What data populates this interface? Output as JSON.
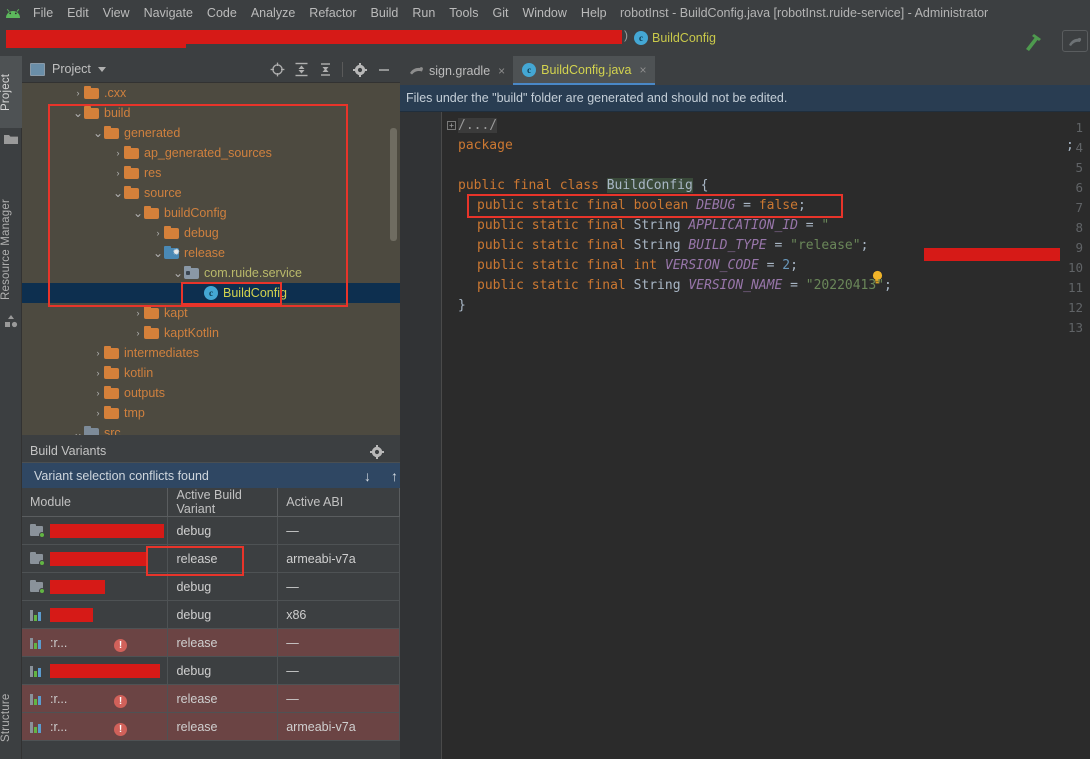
{
  "menu": {
    "logo_icon": "android-logo-icon",
    "items": [
      "File",
      "Edit",
      "View",
      "Navigate",
      "Code",
      "Analyze",
      "Refactor",
      "Build",
      "Run",
      "Tools",
      "Git",
      "Window",
      "Help"
    ],
    "window_title": "robotInst - BuildConfig.java [robotInst.ruide-service] - Administrator"
  },
  "navbar": {
    "breadcrumb_redacted": true,
    "separator": ")",
    "class_name": "BuildConfig",
    "class_icon": "c",
    "hammer_icon": "build-hammer-icon",
    "right_button_icon": "gradle-sync-icon"
  },
  "rail": {
    "project_tab": "Project",
    "resource_manager_tab": "Resource Manager",
    "structure_tab": "Structure"
  },
  "project_panel": {
    "title": "Project",
    "actions": [
      "locate-icon",
      "expand-all-icon",
      "collapse-all-icon",
      "settings-gear-icon",
      "hide-icon"
    ],
    "tree": [
      {
        "indent": 1,
        "arrow": "›",
        "icon": "folder",
        "label": ".cxx",
        "selected": false
      },
      {
        "indent": 1,
        "arrow": "⌄",
        "icon": "folder",
        "label": "build",
        "selected": false
      },
      {
        "indent": 2,
        "arrow": "⌄",
        "icon": "folder",
        "label": "generated",
        "selected": false
      },
      {
        "indent": 3,
        "arrow": "›",
        "icon": "folder",
        "label": "ap_generated_sources",
        "selected": false
      },
      {
        "indent": 3,
        "arrow": "›",
        "icon": "folder",
        "label": "res",
        "selected": false
      },
      {
        "indent": 3,
        "arrow": "⌄",
        "icon": "folder",
        "label": "source",
        "selected": false
      },
      {
        "indent": 4,
        "arrow": "⌄",
        "icon": "folder",
        "label": "buildConfig",
        "selected": false
      },
      {
        "indent": 5,
        "arrow": "›",
        "icon": "folder",
        "label": "debug",
        "selected": false
      },
      {
        "indent": 5,
        "arrow": "⌄",
        "icon": "folder-release",
        "label": "release",
        "selected": false
      },
      {
        "indent": 6,
        "arrow": "⌄",
        "icon": "folder-package",
        "label": "com.ruide.service",
        "selected": false
      },
      {
        "indent": 7,
        "arrow": "",
        "icon": "java-class",
        "label": "BuildConfig",
        "selected": true
      },
      {
        "indent": 4,
        "arrow": "›",
        "icon": "folder",
        "label": "kapt",
        "selected": false
      },
      {
        "indent": 4,
        "arrow": "›",
        "icon": "folder",
        "label": "kaptKotlin",
        "selected": false
      },
      {
        "indent": 2,
        "arrow": "›",
        "icon": "folder",
        "label": "intermediates",
        "selected": false
      },
      {
        "indent": 2,
        "arrow": "›",
        "icon": "folder",
        "label": "kotlin",
        "selected": false
      },
      {
        "indent": 2,
        "arrow": "›",
        "icon": "folder",
        "label": "outputs",
        "selected": false
      },
      {
        "indent": 2,
        "arrow": "›",
        "icon": "folder",
        "label": "tmp",
        "selected": false
      },
      {
        "indent": 1,
        "arrow": "⌄",
        "icon": "folder-src",
        "label": "src",
        "selected": false
      }
    ]
  },
  "build_variants": {
    "title": "Build Variants",
    "actions": [
      "settings-gear-icon",
      "hide-icon"
    ],
    "conflict_banner": "Variant selection conflicts found",
    "conflict_down_icon": "↓",
    "conflict_up_icon": "↑",
    "columns": [
      "Module",
      "Active Build Variant",
      "Active ABI"
    ],
    "rows": [
      {
        "module": "",
        "module_redacted": true,
        "redact_width": 114,
        "icon": "library-module-icon",
        "variant": "debug",
        "abi": "—",
        "warn": false
      },
      {
        "module": "",
        "module_redacted": true,
        "redact_width": 98,
        "icon": "library-module-icon",
        "variant": "release",
        "abi": "armeabi-v7a",
        "warn": false
      },
      {
        "module": "",
        "module_redacted": true,
        "redact_width": 55,
        "icon": "library-module-icon",
        "variant": "debug",
        "abi": "—",
        "warn": false
      },
      {
        "module": "",
        "module_redacted": true,
        "redact_width": 43,
        "icon": "app-module-icon",
        "variant": "debug",
        "abi": "x86",
        "warn": false
      },
      {
        "module": ":r...",
        "module_redacted": false,
        "redact_width": 0,
        "icon": "app-module-icon",
        "variant": "release",
        "abi": "—",
        "warn": true
      },
      {
        "module": "",
        "module_redacted": true,
        "redact_width": 110,
        "icon": "app-module-icon",
        "variant": "debug",
        "abi": "—",
        "warn": false
      },
      {
        "module": ":r...",
        "module_redacted": false,
        "redact_width": 0,
        "icon": "app-module-icon",
        "variant": "release",
        "abi": "—",
        "warn": true
      },
      {
        "module": ":r...",
        "module_redacted": false,
        "redact_width": 0,
        "icon": "app-module-icon",
        "variant": "release",
        "abi": "armeabi-v7a",
        "warn": true
      }
    ]
  },
  "editor": {
    "tabs": [
      {
        "label": "sign.gradle",
        "icon": "gradle-file-icon",
        "active": false,
        "close_icon": "×"
      },
      {
        "label": "BuildConfig.java",
        "icon": "java-class-icon",
        "active": true,
        "close_icon": "×"
      }
    ],
    "notice": "Files under the \"build\" folder are generated and should not be edited.",
    "line_numbers": [
      "1",
      "4",
      "5",
      "6",
      "7",
      "8",
      "9",
      "10",
      "11",
      "12",
      "13"
    ],
    "code_lines": [
      {
        "no": "1",
        "text": "/.../",
        "folded": true
      },
      {
        "no": "4",
        "text": "package ███;"
      },
      {
        "no": "5",
        "text": ""
      },
      {
        "no": "6",
        "text": "public final class BuildConfig {"
      },
      {
        "no": "7",
        "text": "  public static final boolean DEBUG = false;"
      },
      {
        "no": "8",
        "text": "  public static final String APPLICATION_ID = \"███\";"
      },
      {
        "no": "9",
        "text": "  public static final String BUILD_TYPE = \"release\";"
      },
      {
        "no": "10",
        "text": "  public static final int VERSION_CODE = 2;"
      },
      {
        "no": "11",
        "text": "  public static final String VERSION_NAME = \"20220413\";"
      },
      {
        "no": "12",
        "text": "}"
      },
      {
        "no": "13",
        "text": ""
      }
    ],
    "tokens": {
      "keyword_package": "package",
      "keyword_public": "public",
      "keyword_final": "final",
      "keyword_static": "static",
      "keyword_class": "class",
      "keyword_boolean": "boolean",
      "keyword_int": "int",
      "type_string": "String",
      "class_name": "BuildConfig",
      "field_debug": "DEBUG",
      "field_application_id": "APPLICATION_ID",
      "field_build_type": "BUILD_TYPE",
      "field_version_code": "VERSION_CODE",
      "field_version_name": "VERSION_NAME",
      "value_false": "false",
      "value_build_type": "\"release\"",
      "value_version_code": "2",
      "value_version_name": "\"20220413\"",
      "fold_placeholder": "/.../",
      "bulb_icon": "intention-bulb-icon"
    }
  },
  "colors": {
    "annotation_red": "#e8342a",
    "redaction_red": "#d61a17",
    "tree_background": "#4d4a40",
    "selection_blue": "#0d2f4f",
    "editor_background": "#2b2b2b",
    "notice_background": "#293d52",
    "warn_row": "#6b4444",
    "accent_tab": "#4a88c7"
  }
}
